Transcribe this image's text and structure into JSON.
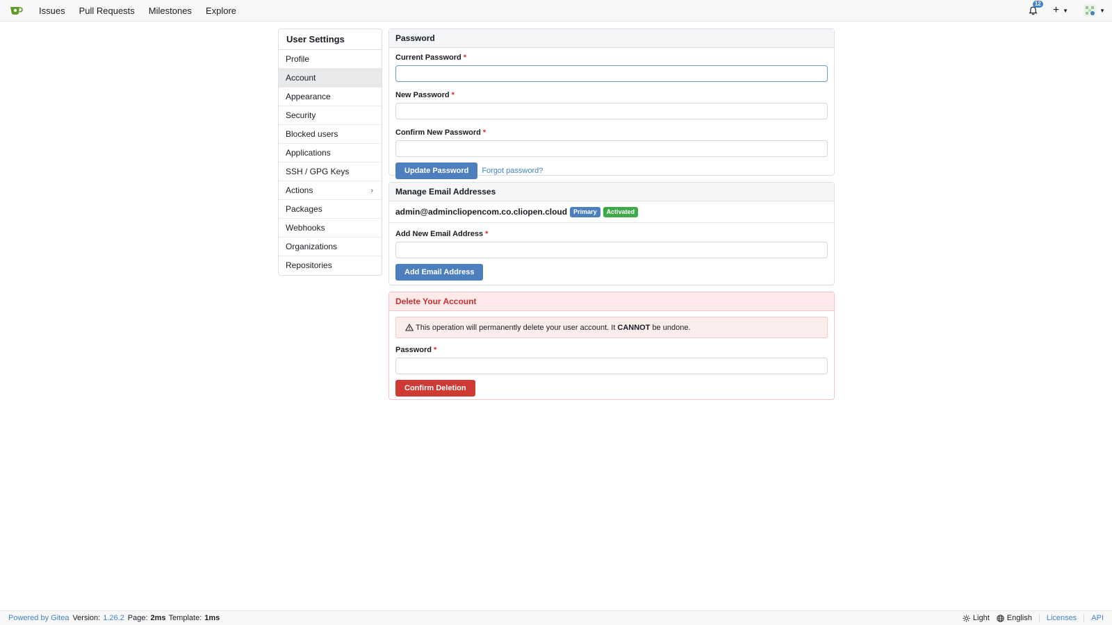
{
  "nav": {
    "links": [
      "Issues",
      "Pull Requests",
      "Milestones",
      "Explore"
    ],
    "notification_count": "12"
  },
  "sidebar": {
    "title": "User Settings",
    "items": [
      {
        "label": "Profile"
      },
      {
        "label": "Account",
        "active": true
      },
      {
        "label": "Appearance"
      },
      {
        "label": "Security"
      },
      {
        "label": "Blocked users"
      },
      {
        "label": "Applications"
      },
      {
        "label": "SSH / GPG Keys"
      },
      {
        "label": "Actions",
        "has_submenu": true
      },
      {
        "label": "Packages"
      },
      {
        "label": "Webhooks"
      },
      {
        "label": "Organizations"
      },
      {
        "label": "Repositories"
      }
    ]
  },
  "password": {
    "title": "Password",
    "current_label": "Current Password",
    "new_label": "New Password",
    "confirm_label": "Confirm New Password",
    "required_mark": "*",
    "current_value": "",
    "new_value": "",
    "confirm_value": "",
    "update_button": "Update Password",
    "forgot_link": "Forgot password?"
  },
  "email": {
    "title": "Manage Email Addresses",
    "address": "admin@admincliopencom.co.cliopen.cloud",
    "primary_badge": "Primary",
    "activated_badge": "Activated",
    "add_label": "Add New Email Address",
    "add_value": "",
    "add_button": "Add Email Address"
  },
  "delete": {
    "title": "Delete Your Account",
    "warning_pre": "This operation will permanently delete your user account. It",
    "warning_bold": "CANNOT",
    "warning_post": "be undone.",
    "password_label": "Password",
    "password_value": "",
    "confirm_button": "Confirm Deletion"
  },
  "footer": {
    "powered_by": "Powered by Gitea",
    "version_label": "Version:",
    "version": "1.26.2",
    "page_label": "Page:",
    "page_time": "2ms",
    "template_label": "Template:",
    "template_time": "1ms",
    "theme": "Light",
    "language": "English",
    "licenses": "Licenses",
    "api": "API"
  },
  "colors": {
    "primary": "#4d7fbf",
    "danger": "#d03a35",
    "success": "#3fa94a",
    "link": "#4183c4"
  }
}
